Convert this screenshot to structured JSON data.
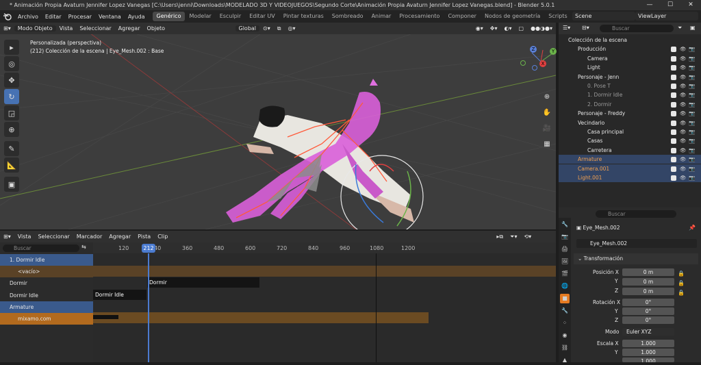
{
  "window": {
    "title": "* Animación Propia Avaturn Jennifer Lopez Vanegas [C:\\Users\\jenni\\Downloads\\MODELADO 3D Y VIDEOJUEGOS\\Segundo Corte\\Animación Propia Avaturn Jennifer Lopez Vanegas.blend] - Blender 5.0.1",
    "minimize": "—",
    "maximize": "☐",
    "close": "✕"
  },
  "menu": [
    "Archivo",
    "Editar",
    "Procesar",
    "Ventana",
    "Ayuda"
  ],
  "workspaces": [
    "Genérico",
    "Modelar",
    "Esculpir",
    "Editar UV",
    "Pintar texturas",
    "Sombreado",
    "Animar",
    "Procesamiento",
    "Componer",
    "Nodos de geometría",
    "Scripts"
  ],
  "active_workspace": "Genérico",
  "add_workspace": "+",
  "scene": "Scene",
  "view_layer": "ViewLayer",
  "viewport_header": {
    "mode": "Modo Objeto",
    "items": [
      "Vista",
      "Seleccionar",
      "Agregar",
      "Objeto"
    ],
    "orientation": "Global"
  },
  "viewport_info": {
    "line1": "Personalizada (perspectiva)",
    "line2": "(212) Colección de la escena | Eye_Mesh.002 : Base"
  },
  "gizmo": {
    "x": "X",
    "y": "Y",
    "z": "Z"
  },
  "outliner": {
    "search_placeholder": "Buscar",
    "rows": [
      {
        "label": "Colección de la escena",
        "indent": 0
      },
      {
        "label": "Producción",
        "indent": 1
      },
      {
        "label": "Camera",
        "indent": 2
      },
      {
        "label": "Light",
        "indent": 2
      },
      {
        "label": "Personaje - Jenn",
        "indent": 1
      },
      {
        "label": "0. Pose T",
        "indent": 2
      },
      {
        "label": "1. Dormir Idle",
        "indent": 2
      },
      {
        "label": "2. Dormir",
        "indent": 2
      },
      {
        "label": "Personaje - Freddy",
        "indent": 1
      },
      {
        "label": "Vecindario",
        "indent": 1
      },
      {
        "label": "Casa principal",
        "indent": 2
      },
      {
        "label": "Casas",
        "indent": 2
      },
      {
        "label": "Carretera",
        "indent": 2
      },
      {
        "label": "Armature",
        "indent": 1
      },
      {
        "label": "Camera.001",
        "indent": 1
      },
      {
        "label": "Light.001",
        "indent": 1
      }
    ]
  },
  "properties": {
    "search_placeholder": "Buscar",
    "object_name": "Eye_Mesh.002",
    "object_name_field": "Eye_Mesh.002",
    "section": "Transformación",
    "position_label": "Posición X",
    "rotation_label": "Rotación X",
    "scale_label": "Escala X",
    "y": "Y",
    "z": "Z",
    "position": [
      "0 m",
      "0 m",
      "0 m"
    ],
    "rotation": [
      "0°",
      "0°",
      "0°"
    ],
    "mode_label": "Modo",
    "mode_value": "Euler XYZ",
    "scale": [
      "1.000",
      "1.000",
      "1.000"
    ]
  },
  "nla": {
    "menu": [
      "Vista",
      "Seleccionar",
      "Marcador",
      "Agregar",
      "Pista",
      "Clip"
    ],
    "search_placeholder": "Buscar",
    "current_frame": "212",
    "ticks": [
      "120",
      "240",
      "360",
      "480",
      "600",
      "720",
      "840",
      "960",
      "1080",
      "1200"
    ],
    "tracks": [
      "1. Dormir Idle",
      "<vacío>",
      "Dormir",
      "Dormir Idle",
      "Armature",
      "mixamo.com"
    ],
    "strips": {
      "dormir": "Dormir",
      "dormir_idle": "Dormir Idle"
    }
  }
}
